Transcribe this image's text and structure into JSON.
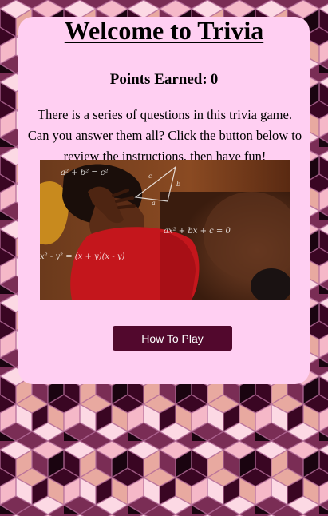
{
  "page": {
    "title": "Welcome to Trivia",
    "points_label": "Points Earned:",
    "points_value": "0",
    "intro": "There is a series of questions in this trivia game. Can you answer them all? Click the button below to review the instructions, then have fun!",
    "how_to_play_label": "How To Play"
  },
  "meme_image": {
    "equations": [
      "a² + b² = c²",
      "ax² + bx + c = 0",
      "x² - y² = (x + y)(x - y)"
    ],
    "triangle_labels": [
      "c",
      "b",
      "a"
    ]
  },
  "colors": {
    "card_background": "#ffcff2",
    "button_background": "#52082d",
    "button_text": "#ffffff",
    "pattern_dark": "#3a0623",
    "pattern_mid": "#7a2d55",
    "pattern_light": "#f5b8c8",
    "pattern_pale": "#fcd9e4"
  }
}
